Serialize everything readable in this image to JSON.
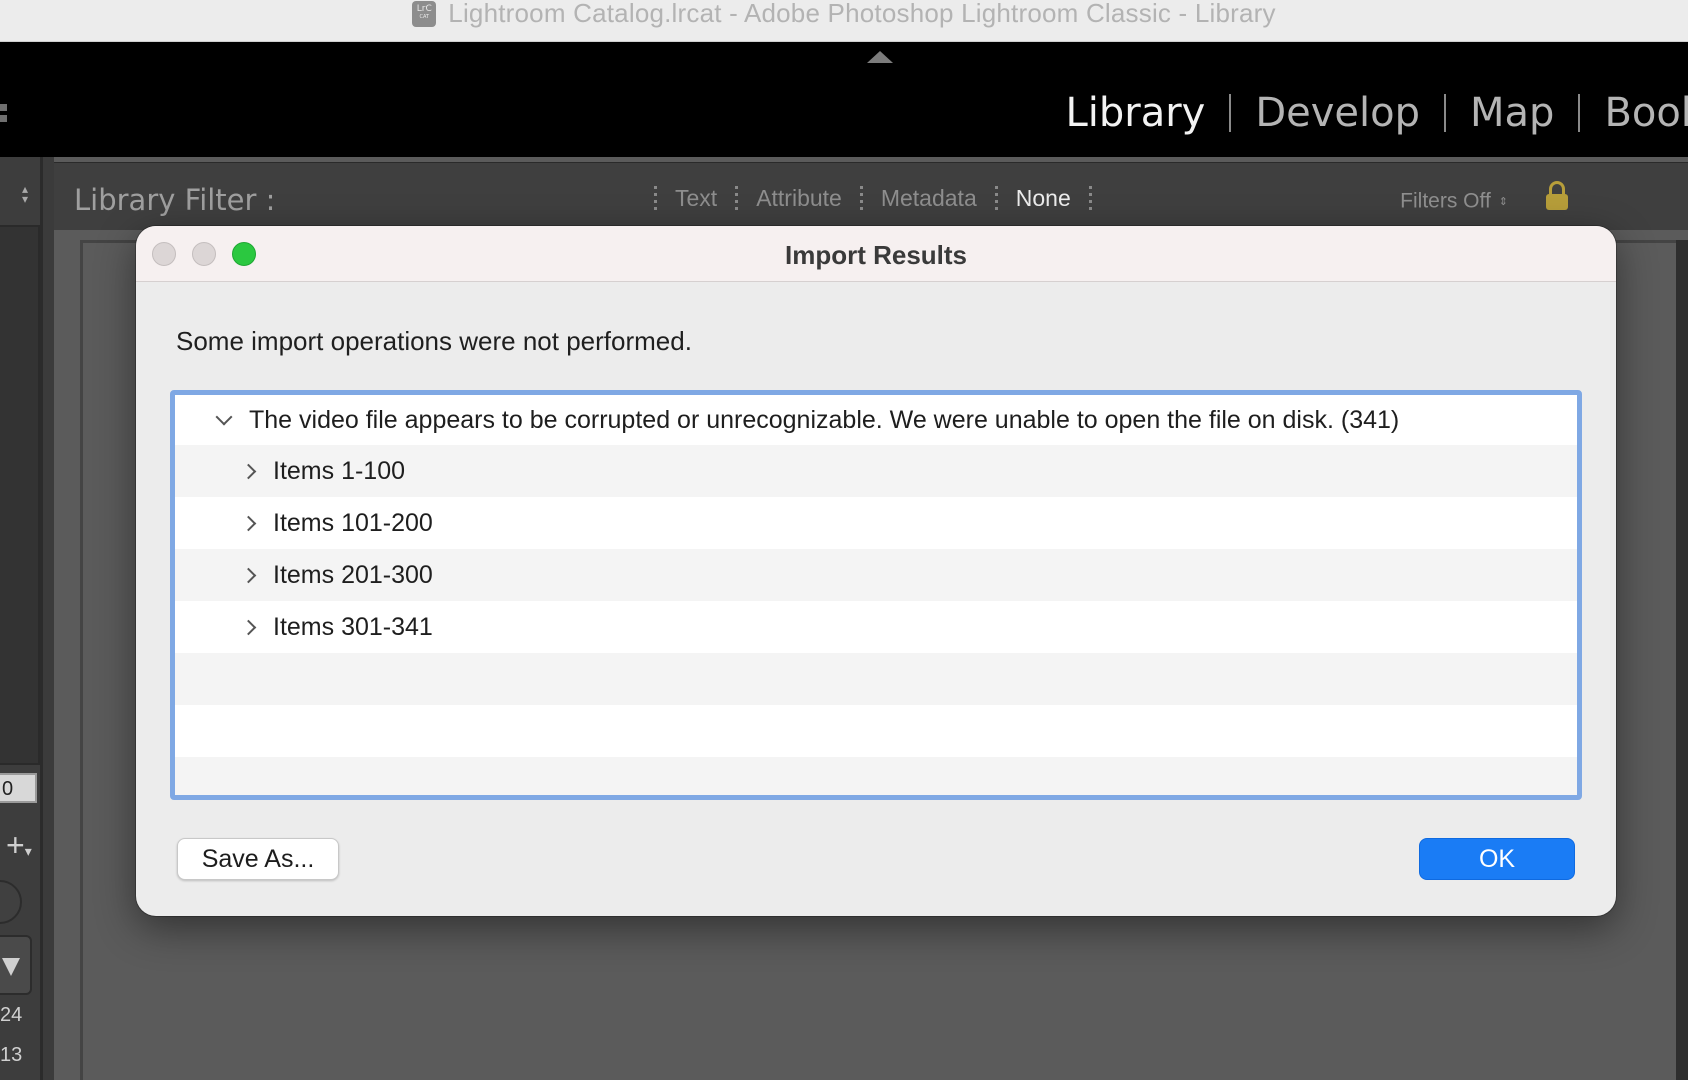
{
  "window": {
    "app_icon_text": "LrC",
    "app_icon_sub": "CAT",
    "title": "Lightroom Catalog.lrcat - Adobe Photoshop Lightroom Classic - Library"
  },
  "modules": {
    "items": [
      {
        "label": "Library",
        "active": true
      },
      {
        "label": "Develop",
        "active": false
      },
      {
        "label": "Map",
        "active": false
      },
      {
        "label": "Book",
        "active": false
      }
    ]
  },
  "filter_bar": {
    "label": "Library Filter :",
    "tabs": [
      "Text",
      "Attribute",
      "Metadata",
      "None"
    ],
    "active_tab": "None",
    "filters_state": "Filters Off"
  },
  "left_panel": {
    "field_value": "0",
    "numbers": [
      "24",
      "13"
    ]
  },
  "dialog": {
    "title": "Import Results",
    "message": "Some import operations were not performed.",
    "tree": {
      "root": "The video file appears to be corrupted or unrecognizable. We were unable to open the file on disk. (341)",
      "children": [
        "Items 1-100",
        "Items 101-200",
        "Items 201-300",
        "Items 301-341"
      ]
    },
    "save_button": "Save As...",
    "ok_button": "OK"
  },
  "colors": {
    "accent": "#1a7cf5",
    "focus_ring": "#7fa8e4",
    "zoom_button": "#2bc840",
    "lock": "#b79e3a"
  }
}
